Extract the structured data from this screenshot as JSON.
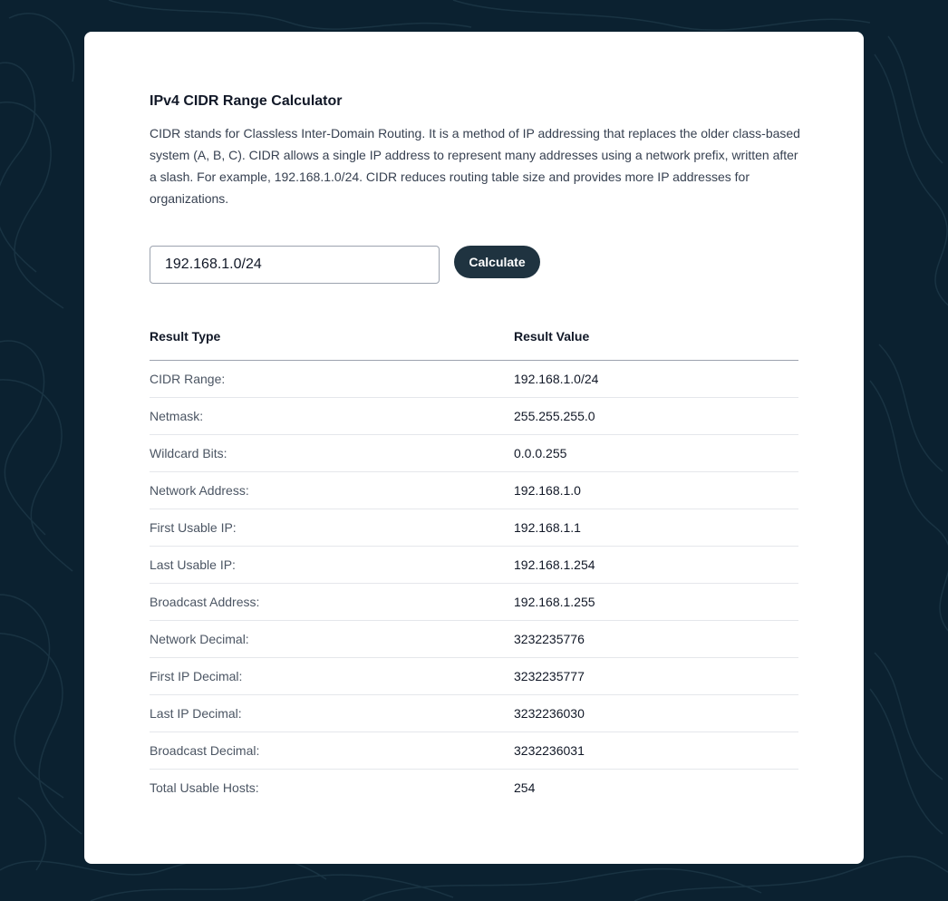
{
  "calculator": {
    "title": "IPv4 CIDR Range Calculator",
    "description": "CIDR stands for Classless Inter-Domain Routing. It is a method of IP addressing that replaces the older class-based system (A, B, C). CIDR allows a single IP address to represent many addresses using a network prefix, written after a slash. For example, 192.168.1.0/24. CIDR reduces routing table size and provides more IP addresses for organizations.",
    "input_value": "192.168.1.0/24",
    "calculate_label": "Calculate"
  },
  "results": {
    "header_type": "Result Type",
    "header_value": "Result Value",
    "rows": [
      {
        "label": "CIDR Range:",
        "value": "192.168.1.0/24"
      },
      {
        "label": "Netmask:",
        "value": "255.255.255.0"
      },
      {
        "label": "Wildcard Bits:",
        "value": "0.0.0.255"
      },
      {
        "label": "Network Address:",
        "value": "192.168.1.0"
      },
      {
        "label": "First Usable IP:",
        "value": "192.168.1.1"
      },
      {
        "label": "Last Usable IP:",
        "value": "192.168.1.254"
      },
      {
        "label": "Broadcast Address:",
        "value": "192.168.1.255"
      },
      {
        "label": "Network Decimal:",
        "value": "3232235776"
      },
      {
        "label": "First IP Decimal:",
        "value": "3232235777"
      },
      {
        "label": "Last IP Decimal:",
        "value": "3232236030"
      },
      {
        "label": "Broadcast Decimal:",
        "value": "3232236031"
      },
      {
        "label": "Total Usable Hosts:",
        "value": "254"
      }
    ]
  },
  "colors": {
    "background": "#0b2130",
    "button": "#1f3340"
  }
}
